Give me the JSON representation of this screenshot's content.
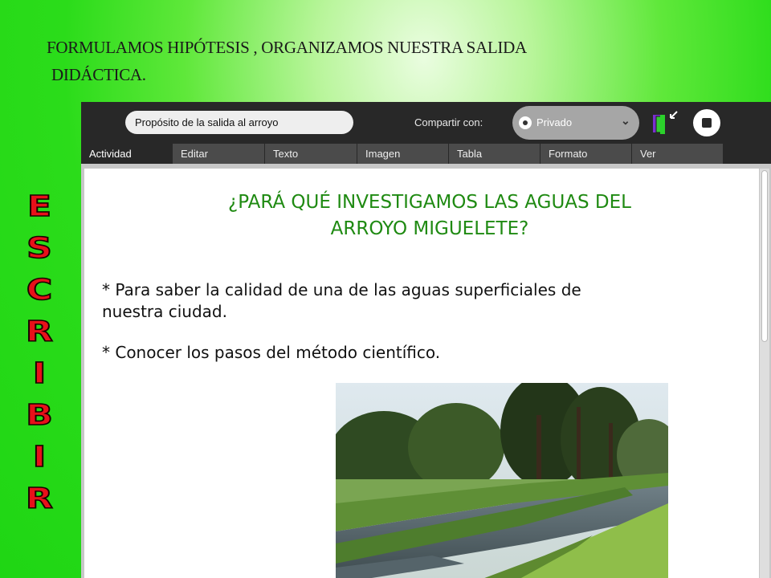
{
  "slide": {
    "title_line1": "FORMULAMOS HIPÓTESIS , ORGANIZAMOS NUESTRA SALIDA",
    "title_line2": "DIDÁCTICA.",
    "side_word_letters": [
      "E",
      "S",
      "C",
      "R",
      "I",
      "B",
      "I",
      "R"
    ]
  },
  "toolbar": {
    "activity_title": "Propósito de la salida al arroyo",
    "share_label": "Compartir con:",
    "share_value": "Privado",
    "journal_icon": "journal-icon",
    "stop_icon": "stop-icon"
  },
  "tabs": [
    {
      "label": "Actividad",
      "active": true
    },
    {
      "label": "Editar",
      "active": false
    },
    {
      "label": "Texto",
      "active": false
    },
    {
      "label": "Imagen",
      "active": false
    },
    {
      "label": "Tabla",
      "active": false
    },
    {
      "label": "Formato",
      "active": false
    },
    {
      "label": "Ver",
      "active": false
    }
  ],
  "document": {
    "heading_line1": "¿PARÁ QUÉ INVESTIGAMOS LAS AGUAS DEL",
    "heading_line2": "ARROYO MIGUELETE?",
    "bullet1_line1": "* Para saber la calidad de una de las aguas superficiales de",
    "bullet1_line2": "nuestra ciudad.",
    "bullet2": "* Conocer los pasos del método científico."
  },
  "colors": {
    "slide_background": "#2bdc1a",
    "side_word": "#e8101a",
    "heading": "#1f8a12",
    "toolbar": "#282828"
  }
}
